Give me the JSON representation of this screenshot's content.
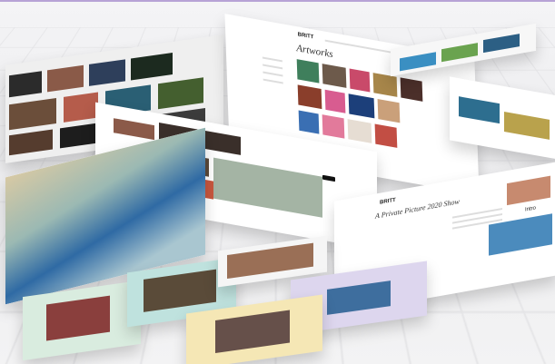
{
  "brand": "BRITT",
  "gallery_heading": "Artworks",
  "article_title": "A Private Picture 2020 Show",
  "side_text": "Intro",
  "colors": {
    "accent": "#b7a3d6",
    "paper": "#ffffff",
    "floor": "#ececee"
  }
}
